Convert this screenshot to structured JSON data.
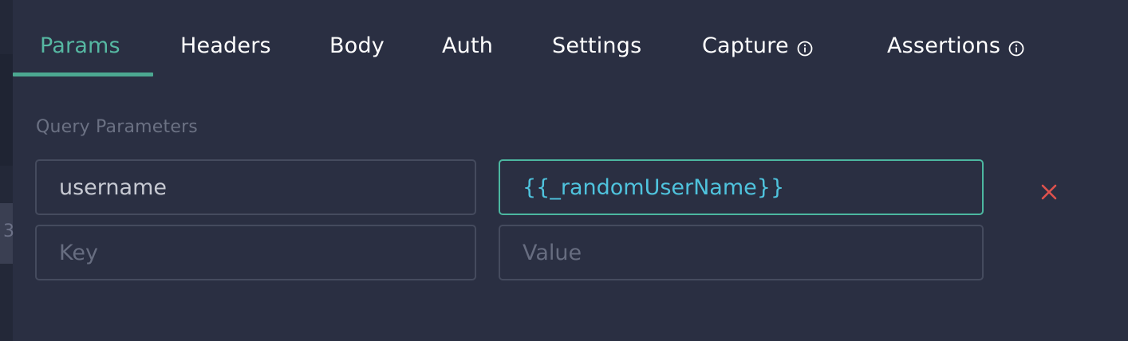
{
  "tabs": [
    {
      "label": "Params",
      "active": true,
      "info": false
    },
    {
      "label": "Headers",
      "active": false,
      "info": false
    },
    {
      "label": "Body",
      "active": false,
      "info": false
    },
    {
      "label": "Auth",
      "active": false,
      "info": false
    },
    {
      "label": "Settings",
      "active": false,
      "info": false
    },
    {
      "label": "Capture",
      "active": false,
      "info": true
    },
    {
      "label": "Assertions",
      "active": false,
      "info": true
    }
  ],
  "query_params": {
    "section_label": "Query Parameters",
    "rows": [
      {
        "key": "username",
        "value": "{{_randomUserName}}"
      }
    ],
    "new_row": {
      "key_placeholder": "Key",
      "value_placeholder": "Value"
    }
  },
  "left_panel_peek": "3",
  "icons": {
    "info": "info-circle-icon",
    "remove": "close-x-icon"
  },
  "colors": {
    "background": "#2a2f42",
    "accent": "#4ca891",
    "active_tab_text": "#56b8a2",
    "variable_text": "#4fc3dd",
    "remove": "#e0524d",
    "label_muted": "#6b7183"
  }
}
